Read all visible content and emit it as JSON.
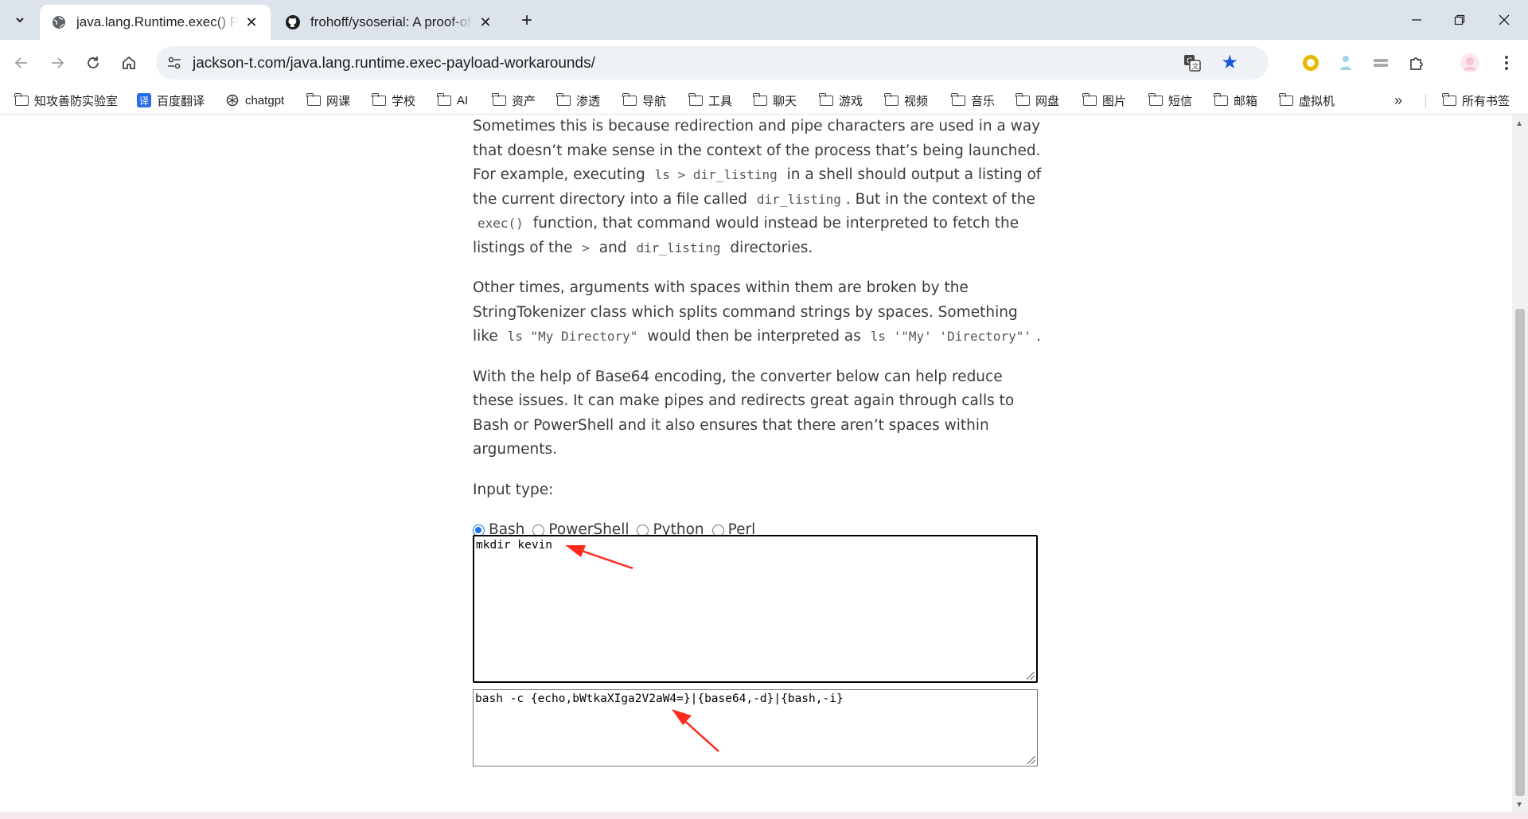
{
  "tabs": [
    {
      "title": "java.lang.Runtime.exec() Payl",
      "active": true
    },
    {
      "title": "frohoff/ysoserial: A proof-of-",
      "active": false
    }
  ],
  "omnibox": {
    "url": "jackson-t.com/java.lang.runtime.exec-payload-workarounds/"
  },
  "bookmarks": [
    {
      "label": "知攻善防实验室",
      "icon": "folder-icon"
    },
    {
      "label": "百度翻译",
      "icon": "translate-icon"
    },
    {
      "label": "chatgpt",
      "icon": "openai-icon"
    },
    {
      "label": "网课",
      "icon": "folder-icon"
    },
    {
      "label": "学校",
      "icon": "folder-icon"
    },
    {
      "label": "AI",
      "icon": "folder-icon"
    },
    {
      "label": "资产",
      "icon": "folder-icon"
    },
    {
      "label": "渗透",
      "icon": "folder-icon"
    },
    {
      "label": "导航",
      "icon": "folder-icon"
    },
    {
      "label": "工具",
      "icon": "folder-icon"
    },
    {
      "label": "聊天",
      "icon": "folder-icon"
    },
    {
      "label": "游戏",
      "icon": "folder-icon"
    },
    {
      "label": "视频",
      "icon": "folder-icon"
    },
    {
      "label": "音乐",
      "icon": "folder-icon"
    },
    {
      "label": "网盘",
      "icon": "folder-icon"
    },
    {
      "label": "图片",
      "icon": "folder-icon"
    },
    {
      "label": "短信",
      "icon": "folder-icon"
    },
    {
      "label": "邮箱",
      "icon": "folder-icon"
    },
    {
      "label": "虚拟机",
      "icon": "folder-icon"
    }
  ],
  "all_bookmarks": "所有书签",
  "article": {
    "p1": {
      "t1": "Sometimes this is because redirection and pipe characters are used in a way that doesn’t make sense in the context of the process that’s being launched. For example, executing",
      "c1": "ls > dir_listing",
      "t2": "in a shell should output a listing of the current directory into a file called",
      "c2": "dir_listing",
      "t3": ". But in the context of the",
      "c3": "exec()",
      "t4": "function, that command would instead be interpreted to fetch the listings of the",
      "c4": ">",
      "t5": "and",
      "c5": "dir_listing",
      "t6": "directories."
    },
    "p2": {
      "t1": "Other times, arguments with spaces within them are broken by the StringTokenizer class which splits command strings by spaces. Something like",
      "c1": "ls \"My Directory\"",
      "t2": "would then be interpreted as",
      "c2": "ls '\"My' 'Directory\"'",
      "t3": "."
    },
    "p3": "With the help of Base64 encoding, the converter below can help reduce these issues. It can make pipes and redirects great again through calls to Bash or PowerShell and it also ensures that there aren’t spaces within arguments.",
    "input_type_label": "Input type:",
    "radio_options": [
      "Bash",
      "PowerShell",
      "Python",
      "Perl"
    ],
    "selected_option": "Bash"
  },
  "input_text": "mkdir kevin",
  "output_text": "bash -c {echo,bWtkaXIga2V2aW4=}|{base64,-d}|{bash,-i}",
  "colors": {
    "accent": "#1a73e8",
    "annotation_arrow": "#ff2a1a",
    "tab_strip": "#dde3ea",
    "star": "#1a57d8"
  }
}
